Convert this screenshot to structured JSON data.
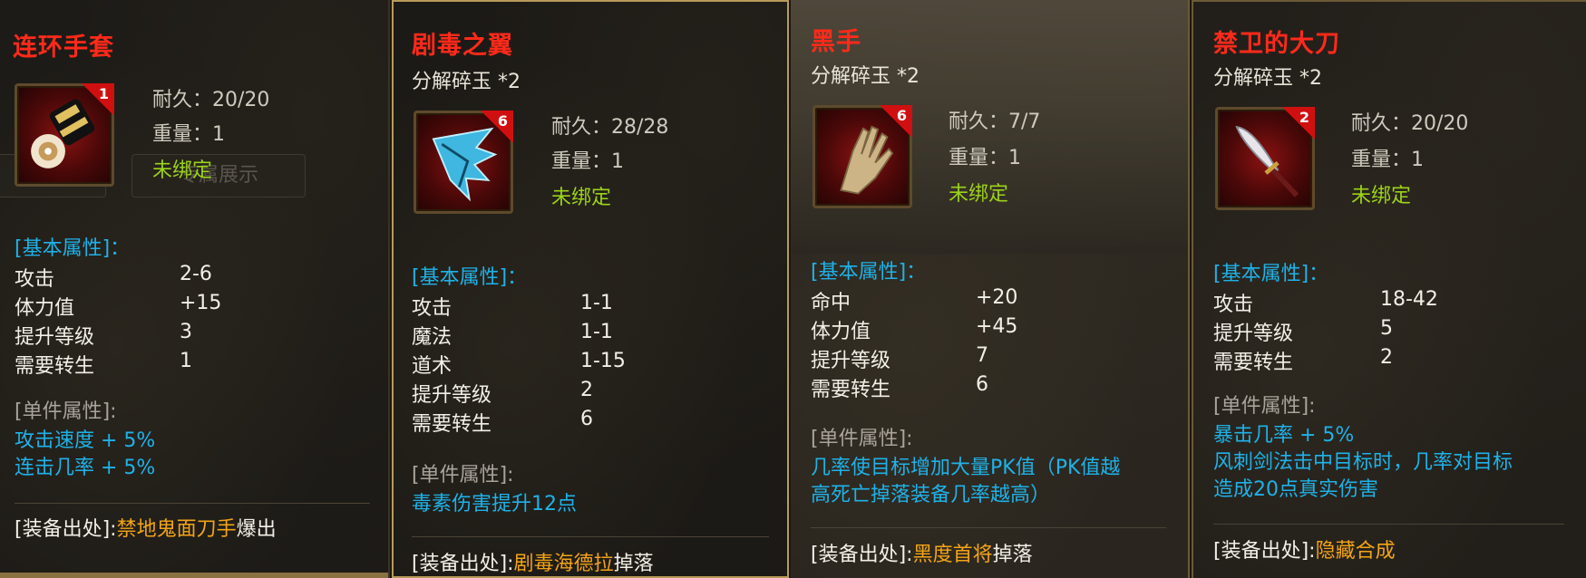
{
  "cards": [
    {
      "name": "连环手套",
      "level_badge": "1",
      "icon": "glove-icon",
      "durability": "耐久：20/20",
      "weight": "重量：1",
      "bind": "未绑定",
      "ghost_labels": [
        "属",
        "专属展示"
      ],
      "basic_header": "[基本属性]：",
      "stats": [
        {
          "k": "攻击",
          "v": "2-6"
        },
        {
          "k": "体力值",
          "v": "+15"
        },
        {
          "k": "提升等级",
          "v": "3"
        },
        {
          "k": "需要转生",
          "v": "1"
        }
      ],
      "single_header": "[单件属性]:",
      "single_lines": [
        "攻击速度 + 5%",
        "连击几率 + 5%"
      ],
      "source_prefix": "[装备出处]:",
      "source_value": "禁地鬼面刀手",
      "source_suffix": "爆出"
    },
    {
      "name": "剧毒之翼",
      "subtitle": "分解碎玉 *2",
      "level_badge": "6",
      "icon": "wing-icon",
      "durability": "耐久：28/28",
      "weight": "重量：1",
      "bind": "未绑定",
      "basic_header": "[基本属性]：",
      "stats": [
        {
          "k": "攻击",
          "v": "1-1"
        },
        {
          "k": "魔法",
          "v": "1-1"
        },
        {
          "k": "道术",
          "v": "1-15"
        },
        {
          "k": "提升等级",
          "v": "2"
        },
        {
          "k": "需要转生",
          "v": "6"
        }
      ],
      "single_header": "[单件属性]:",
      "single_lines": [
        "毒素伤害提升12点"
      ],
      "source_prefix": "[装备出处]:",
      "source_value": "剧毒海德拉",
      "source_suffix": "掉落"
    },
    {
      "name": "黑手",
      "subtitle": "分解碎玉 *2",
      "level_badge": "6",
      "icon": "hand-icon",
      "durability": "耐久：7/7",
      "weight": "重量：1",
      "bind": "未绑定",
      "basic_header": "[基本属性]：",
      "stats": [
        {
          "k": "命中",
          "v": "+20"
        },
        {
          "k": "体力值",
          "v": "+45"
        },
        {
          "k": "提升等级",
          "v": "7"
        },
        {
          "k": "需要转生",
          "v": "6"
        }
      ],
      "single_header": "[单件属性]:",
      "single_lines": [
        "几率使目标增加大量PK值（PK值越",
        "高死亡掉落装备几率越高）"
      ],
      "source_prefix": "[装备出处]:",
      "source_value": "黑度首将",
      "source_suffix": "掉落"
    },
    {
      "name": "禁卫的大刀",
      "subtitle": "分解碎玉 *2",
      "level_badge": "2",
      "icon": "blade-icon",
      "durability": "耐久：20/20",
      "weight": "重量：1",
      "bind": "未绑定",
      "basic_header": "[基本属性]：",
      "stats": [
        {
          "k": "攻击",
          "v": "18-42"
        },
        {
          "k": "提升等级",
          "v": "5"
        },
        {
          "k": "需要转生",
          "v": "2"
        }
      ],
      "single_header": "[单件属性]:",
      "single_lines": [
        "暴击几率 + 5%",
        "风刺剑法击中目标时，几率对目标",
        "造成20点真实伤害"
      ],
      "source_prefix": "[装备出处]:",
      "source_value": "隐藏合成",
      "source_suffix": ""
    }
  ]
}
